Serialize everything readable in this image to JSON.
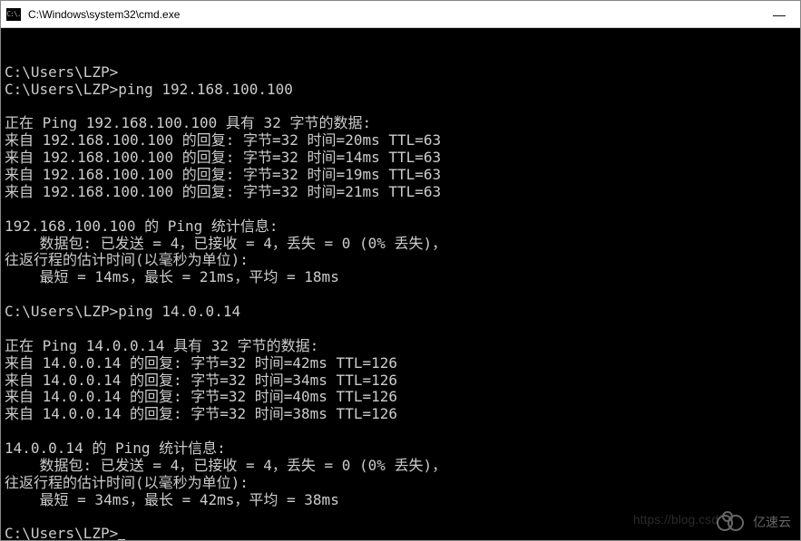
{
  "titlebar": {
    "icon_text": "C:\\.",
    "title": "C:\\Windows\\system32\\cmd.exe",
    "minimize": "—"
  },
  "terminal": {
    "lines": [
      "C:\\Users\\LZP>",
      "C:\\Users\\LZP>ping 192.168.100.100",
      "",
      "正在 Ping 192.168.100.100 具有 32 字节的数据:",
      "来自 192.168.100.100 的回复: 字节=32 时间=20ms TTL=63",
      "来自 192.168.100.100 的回复: 字节=32 时间=14ms TTL=63",
      "来自 192.168.100.100 的回复: 字节=32 时间=19ms TTL=63",
      "来自 192.168.100.100 的回复: 字节=32 时间=21ms TTL=63",
      "",
      "192.168.100.100 的 Ping 统计信息:",
      "    数据包: 已发送 = 4，已接收 = 4，丢失 = 0 (0% 丢失)，",
      "往返行程的估计时间(以毫秒为单位):",
      "    最短 = 14ms，最长 = 21ms，平均 = 18ms",
      "",
      "C:\\Users\\LZP>ping 14.0.0.14",
      "",
      "正在 Ping 14.0.0.14 具有 32 字节的数据:",
      "来自 14.0.0.14 的回复: 字节=32 时间=42ms TTL=126",
      "来自 14.0.0.14 的回复: 字节=32 时间=34ms TTL=126",
      "来自 14.0.0.14 的回复: 字节=32 时间=40ms TTL=126",
      "来自 14.0.0.14 的回复: 字节=32 时间=38ms TTL=126",
      "",
      "14.0.0.14 的 Ping 统计信息:",
      "    数据包: 已发送 = 4，已接收 = 4，丢失 = 0 (0% 丢失)，",
      "往返行程的估计时间(以毫秒为单位):",
      "    最短 = 34ms，最长 = 42ms，平均 = 38ms",
      "",
      "C:\\Users\\LZP>"
    ]
  },
  "watermark": {
    "text": "https://blog.csd",
    "logo_text": "亿速云"
  }
}
